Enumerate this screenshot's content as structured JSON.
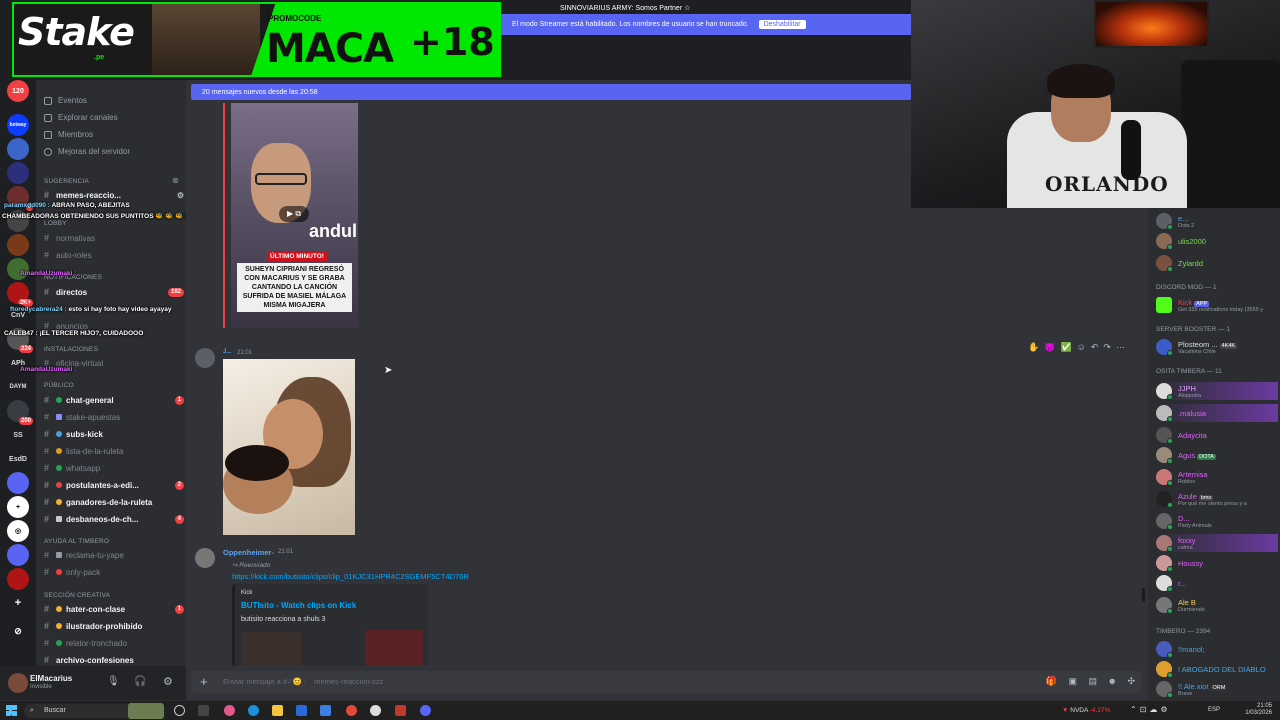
{
  "stream_overlay": {
    "top_line": "SINNOVIARIUS ARMY: Somos Partner ☆",
    "streamer_mode_text": "El modo Streamer está habilitado. Los nombres de usuario se han truncado.",
    "streamer_mode_button": "Deshabilitar",
    "promo": {
      "brand": "Stake",
      "brand_suffix": ".pe",
      "promocode_label": "PROMOCODE",
      "code": "MACA",
      "age": "+18"
    },
    "webcam_shirt_text": "ORLANDO"
  },
  "colors": {
    "discord_blurple": "#5865f2",
    "stake_green": "#00e701",
    "mention_red": "#f23f43",
    "online_green": "#23a55a",
    "link_blue": "#00a8fc"
  },
  "server_rail": [
    {
      "label": "120",
      "badge": ""
    },
    {
      "label": "betway",
      "badge": ""
    },
    {
      "label": "",
      "badge": ""
    },
    {
      "label": "",
      "badge": ""
    },
    {
      "label": "",
      "badge": "2"
    },
    {
      "label": "",
      "badge": ""
    },
    {
      "label": "",
      "badge": ""
    },
    {
      "label": "",
      "badge": ""
    },
    {
      "label": "",
      "badge": "2K+"
    },
    {
      "label": "CnV",
      "badge": ""
    },
    {
      "label": "",
      "badge": "224"
    },
    {
      "label": "APh",
      "badge": ""
    },
    {
      "label": "DAYM",
      "badge": ""
    },
    {
      "label": "",
      "badge": "200"
    },
    {
      "label": "SS",
      "badge": ""
    },
    {
      "label": "EsdD",
      "badge": ""
    }
  ],
  "sidebar": {
    "menu": [
      {
        "label": "Eventos"
      },
      {
        "label": "Explorar canales"
      },
      {
        "label": "Miembros"
      },
      {
        "label": "Mejoras del servidor"
      }
    ],
    "suggestion_label": "Sugerencia",
    "categories": {
      "lobby": "LOBBY",
      "notificaciones": "NOTIFICACIONES",
      "instalaciones": "INSTALACIONES",
      "publico": "PÚBLICO",
      "ayuda": "AYUDA AL TIMBERO",
      "creativa": "SECCIÓN CREATIVA"
    },
    "channels": [
      {
        "name": "memes-reaccio...",
        "unread": true,
        "mention": ""
      },
      {
        "name": "normativas",
        "unread": false,
        "mention": ""
      },
      {
        "name": "auto-roles",
        "unread": false,
        "mention": ""
      },
      {
        "name": "directos",
        "unread": true,
        "mention": "192"
      },
      {
        "name": "anuncios",
        "unread": false,
        "mention": ""
      },
      {
        "name": "oficina-virtual",
        "unread": false,
        "mention": ""
      },
      {
        "name": "chat-general",
        "unread": true,
        "mention": "1"
      },
      {
        "name": "stake-apuestas",
        "unread": false,
        "mention": ""
      },
      {
        "name": "subs-kick",
        "unread": true,
        "mention": ""
      },
      {
        "name": "lista-de-la-ruleta",
        "unread": false,
        "mention": ""
      },
      {
        "name": "whatsapp",
        "unread": false,
        "mention": ""
      },
      {
        "name": "postulantes-a-edi...",
        "unread": true,
        "mention": "2"
      },
      {
        "name": "ganadores-de-la-ruleta",
        "unread": true,
        "mention": ""
      },
      {
        "name": "desbaneos-de-ch...",
        "unread": true,
        "mention": "4"
      },
      {
        "name": "reclama-tu-yape",
        "unread": false,
        "mention": ""
      },
      {
        "name": "only-pack",
        "unread": false,
        "mention": ""
      },
      {
        "name": "hater-con-clase",
        "unread": true,
        "mention": "1"
      },
      {
        "name": "ilustrador-prohibido",
        "unread": true,
        "mention": ""
      },
      {
        "name": "relator-tronchado",
        "unread": false,
        "mention": ""
      },
      {
        "name": "archivo-confesiones",
        "unread": true,
        "mention": ""
      }
    ]
  },
  "chat_overlay": [
    {
      "user": "paramxdd090 :",
      "text": "ABRAN PASO, ABEJITAS"
    },
    {
      "user": "",
      "text": "CHAMBEADORAS OBTENIENDO SUS PUNTITOS"
    },
    {
      "user": "AmandaUzumaki :",
      "text": ""
    },
    {
      "user": "ftoredycabrera24 :",
      "text": "esto si hay foto hay video ayayay"
    },
    {
      "user": "",
      "text": "CALEB47 : ¡EL TERCER HIJO?, CUIDADOOO"
    },
    {
      "user": "AmandaUzumaki :",
      "text": ""
    }
  ],
  "user_panel": {
    "name": "ElMacarius",
    "status": "Invisible"
  },
  "main": {
    "new_messages_banner": "20 mensajes nuevos desde las 20:58",
    "image1": {
      "brand_text": "anduluc",
      "breaking_tag": "ÚLTIMO MINUTO!",
      "caption": "SUHEYN CIPRIANI REGRESÓ CON MACARIUS Y SE GRABA CANTANDO LA CANCIÓN SUFRIDA DE MASIEL MÁLAGA MISMA MIGAJERA"
    },
    "message2": {
      "user": "J...",
      "time": "21:01"
    },
    "message3": {
      "user": "Oppenheimer-",
      "time": "21:01",
      "forwarded": "Reenviado",
      "link": "https://kick.com/butisito/clips/clip_01KJC31HPR4C2SGEMF5CT4D76R",
      "embed_provider": "Kick",
      "embed_title": "BUTIsito - Watch clips on Kick",
      "embed_desc": "butisito reacciona a shuls 3"
    },
    "input_placeholder": "Enviar mensaje a #",
    "input_channel": "memes-reaccion-zzz"
  },
  "members": {
    "groups": [
      {
        "label": "DISCORD MOD — 1"
      },
      {
        "label": "SERVER BOOSTER — 1"
      },
      {
        "label": "OSITA TIMBERA — 11"
      },
      {
        "label": "TIMBERO — 2394"
      }
    ],
    "list": [
      {
        "name": "e...",
        "sub": "Dota 2",
        "color": "#4aa3e0"
      },
      {
        "name": "ulis2000",
        "sub": "",
        "color": "#7ed957"
      },
      {
        "name": "Zylardd",
        "sub": "",
        "color": "#7ed957"
      },
      {
        "name": "Kick",
        "sub": "Get 355 notifications today (3555 y",
        "color": "#f23f43",
        "tag": "APP"
      },
      {
        "name": "Plosteom ...",
        "sub": "Vacations Chile",
        "color": "#dbdee1",
        "tag": "4K4K"
      },
      {
        "name": "JJPH",
        "sub": "Alejandra",
        "color": "#e6a3ff"
      },
      {
        "name": ".malusia",
        "sub": "",
        "color": "#e060ff"
      },
      {
        "name": "Adaycita",
        "sub": "",
        "color": "#e060ff"
      },
      {
        "name": "Agus",
        "sub": "",
        "color": "#e060ff",
        "tag": "DOTA"
      },
      {
        "name": "Artemisa",
        "sub": "Roblox",
        "color": "#e060ff"
      },
      {
        "name": "Azule",
        "sub": "Por qué me siento presa y a",
        "color": "#e060ff",
        "tag": "bmo"
      },
      {
        "name": "D...",
        "sub": "Party Animals",
        "color": "#e060ff"
      },
      {
        "name": "foxxy",
        "sub": "calma",
        "color": "#e060ff"
      },
      {
        "name": "Houssy",
        "sub": "",
        "color": "#e060ff"
      },
      {
        "name": "r...",
        "sub": "",
        "color": "#e060ff"
      },
      {
        "name": "Ale B",
        "sub": "Durmiendo",
        "color": "#f0d05a"
      },
      {
        "name": "!!manol;",
        "sub": "",
        "color": "#4aa3e0"
      },
      {
        "name": "! ABOGADO DEL DIABLO",
        "sub": "",
        "color": "#4aa3e0"
      },
      {
        "name": "!! Ale.xiot",
        "sub": "Brave",
        "color": "#4aa3e0",
        "tag": "ORM"
      }
    ]
  },
  "taskbar": {
    "search": "Buscar",
    "tray_nvda": "NVDA",
    "tray_pct": "-4.27%",
    "time": "21:05",
    "date": "1/03/2026",
    "lang": "ESP"
  }
}
